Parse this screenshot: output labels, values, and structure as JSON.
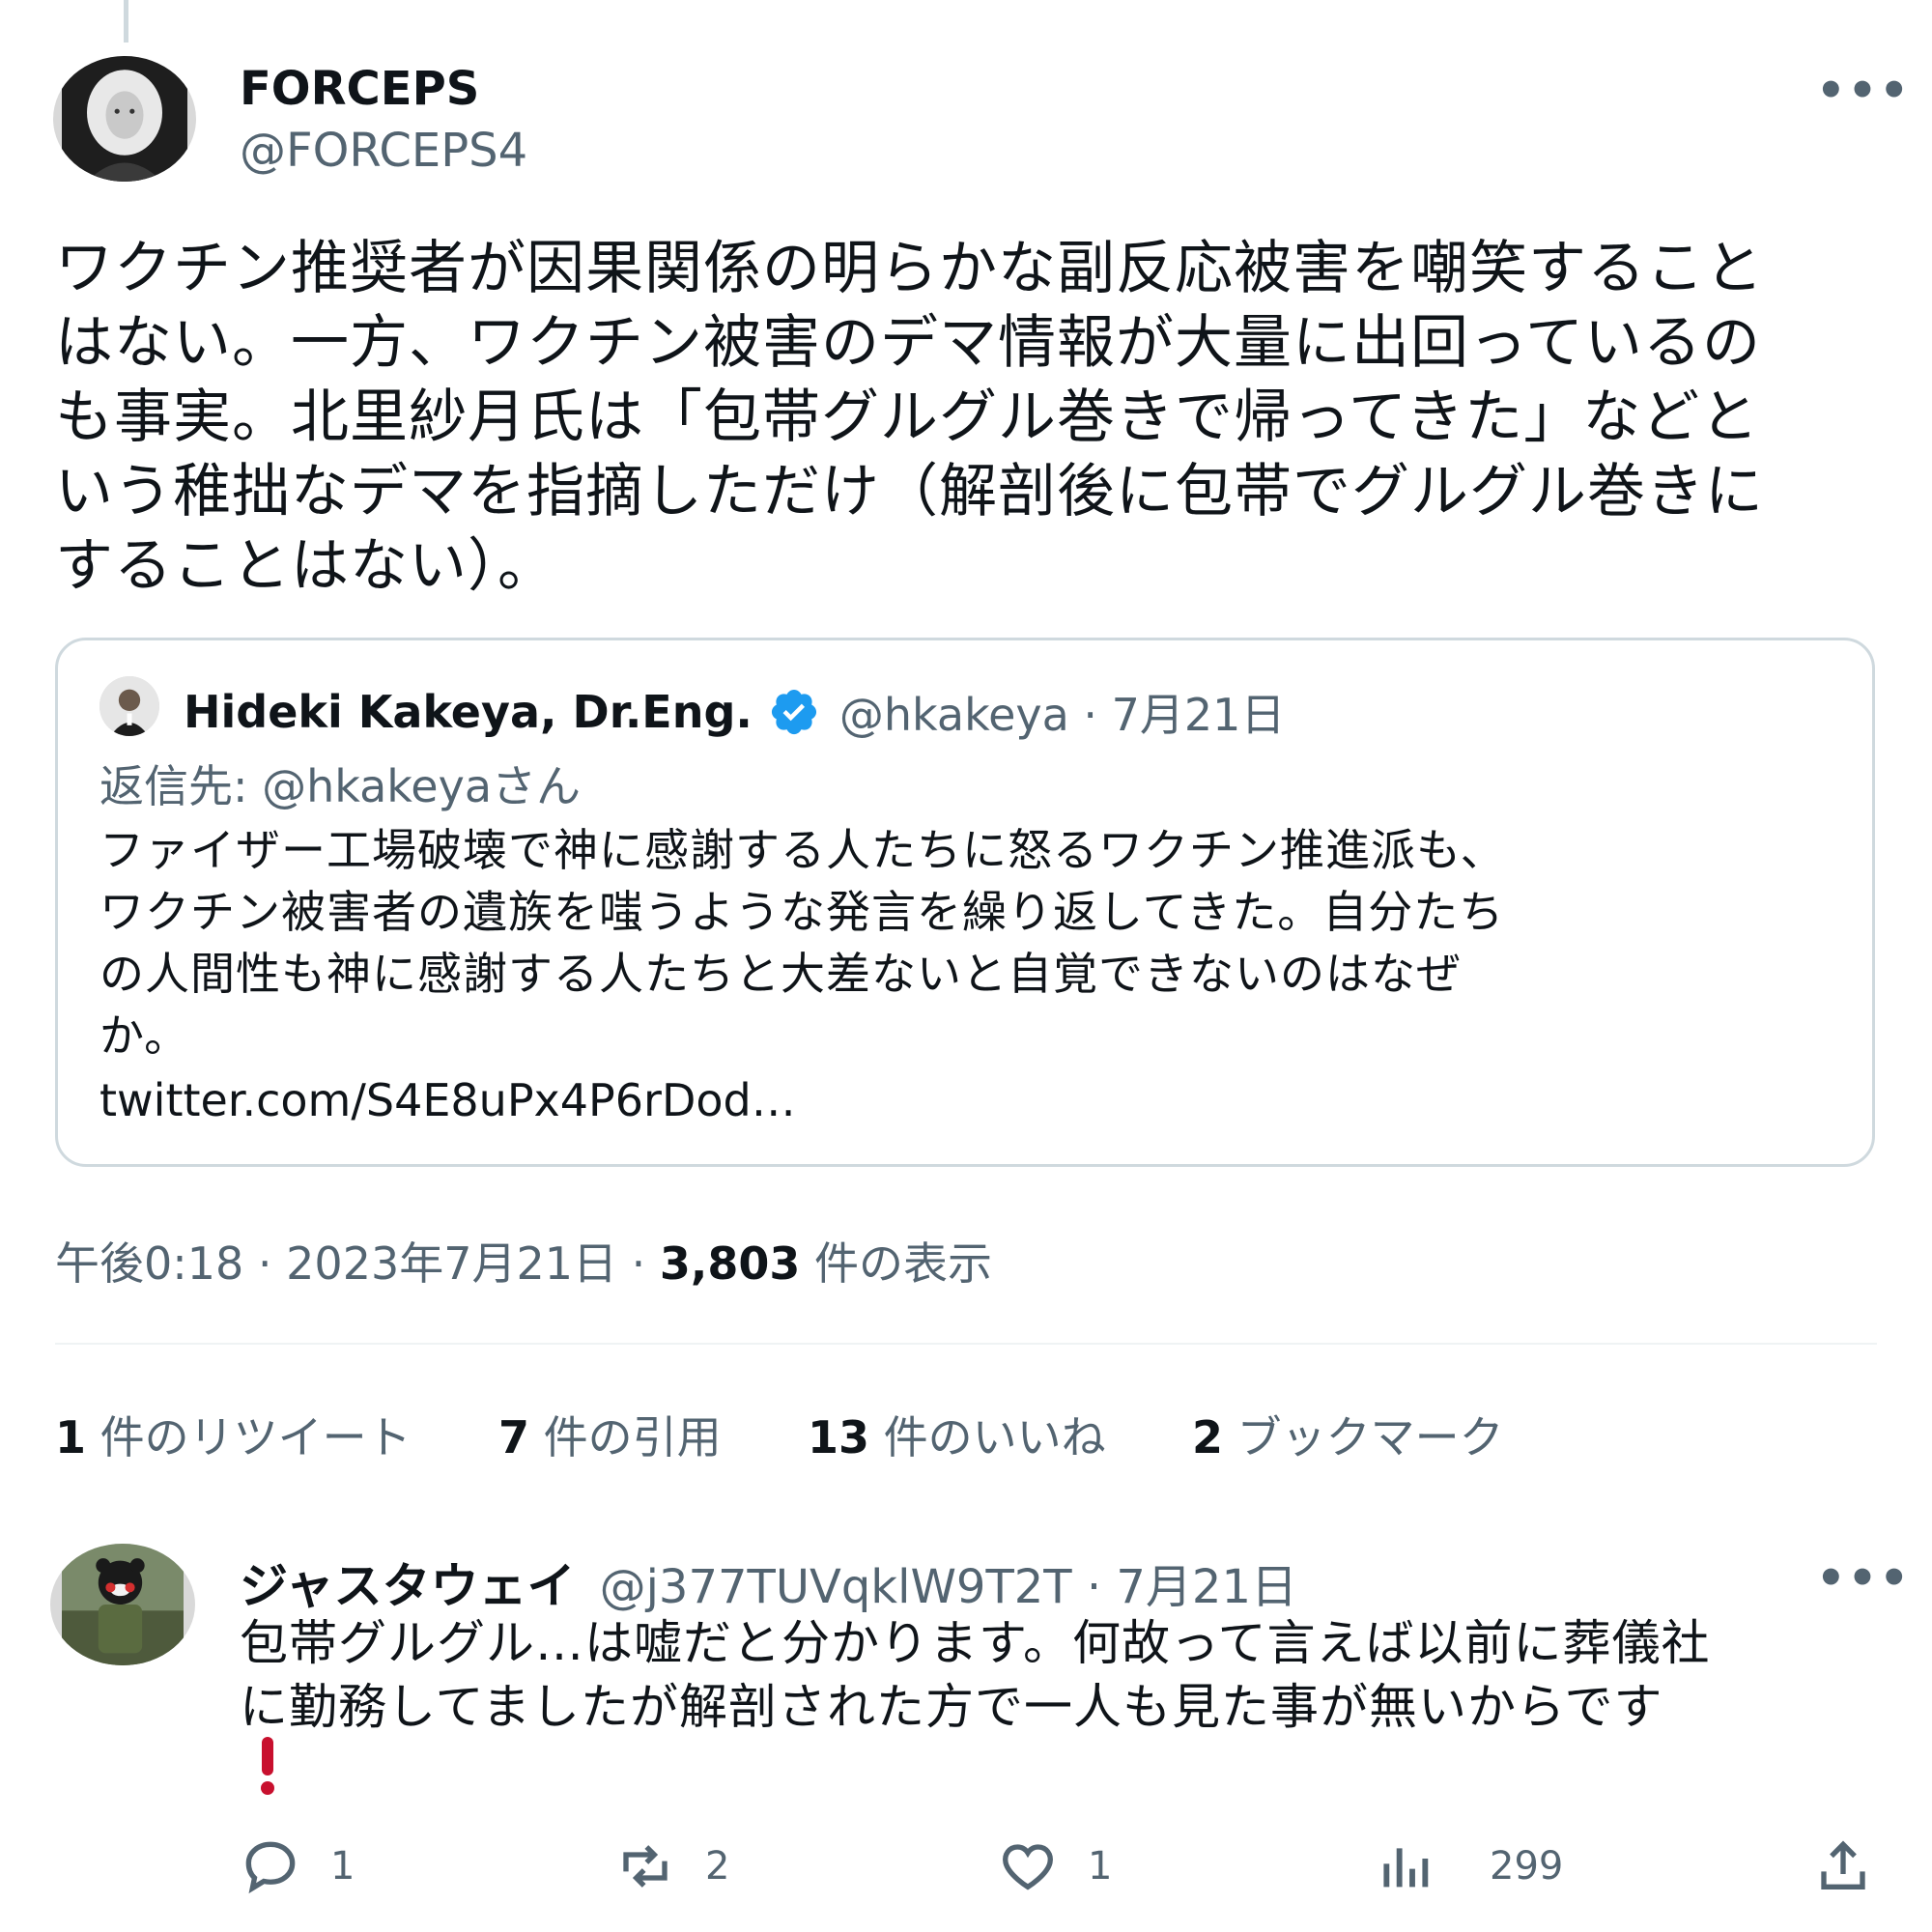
{
  "main_tweet": {
    "display_name": "FORCEPS",
    "handle": "@FORCEPS4",
    "more_label": "•••",
    "text_lines": [
      "ワクチン推奨者が因果関係の明らかな副反応被害を嘲笑すること",
      "はない。一方、ワクチン被害のデマ情報が大量に出回っているの",
      "も事実。北里紗月氏は「包帯グルグル巻きで帰ってきた」などと",
      "いう稚拙なデマを指摘しただけ（解剖後に包帯でグルグル巻きに",
      "することはない）。"
    ],
    "timestamp": "午後0:18 · 2023年7月21日 · ",
    "views_count": "3,803",
    "views_label": " 件の表示"
  },
  "quoted_tweet": {
    "display_name": "Hideki Kakeya, Dr.Eng.",
    "handle_date": "@hkakeya · 7月21日",
    "reply_to": "返信先: @hkakeyaさん",
    "text_lines": [
      "ファイザー工場破壊で神に感謝する人たちに怒るワクチン推進派も、",
      "ワクチン被害者の遺族を嗤うような発言を繰り返してきた。自分たち",
      "の人間性も神に感謝する人たちと大差ないと自覚できないのはなぜ",
      "か。"
    ],
    "link": "twitter.com/S4E8uPx4P6rDod…",
    "verified_color": "#1d9bf0"
  },
  "stats": [
    {
      "count": "1",
      "label": " 件のリツイート"
    },
    {
      "count": "7",
      "label": " 件の引用"
    },
    {
      "count": "13",
      "label": " 件のいいね"
    },
    {
      "count": "2",
      "label": " ブックマーク"
    }
  ],
  "reply": {
    "display_name": "ジャスタウェイ",
    "handle_date": "@j377TUVqklW9T2T · 7月21日",
    "more_label": "•••",
    "text_lines": [
      "包帯グルグル…は嘘だと分かります。何故って言えば以前に葬儀社",
      "に勤務してましたが解剖された方で一人も見た事が無いからです"
    ],
    "emoji": "❗",
    "actions": {
      "reply_count": "1",
      "retweet_count": "2",
      "like_count": "1",
      "views_count": "299"
    }
  },
  "colors": {
    "secondary_text": "#536471",
    "border": "#cfd9de",
    "emoji_red": "#c8102e"
  }
}
